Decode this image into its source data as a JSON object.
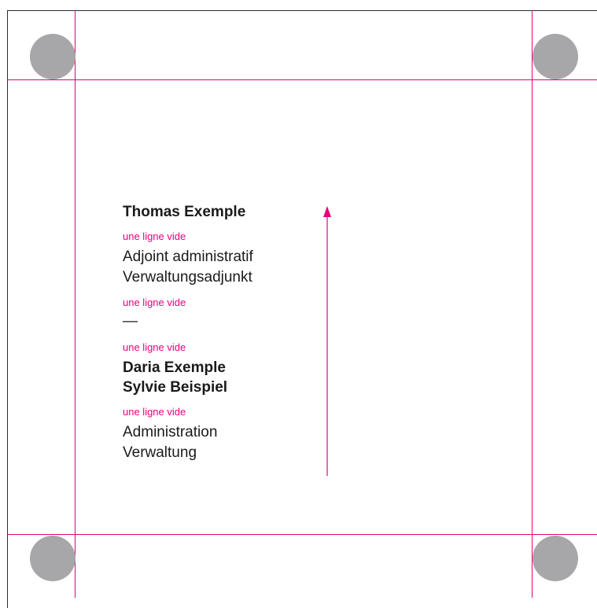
{
  "colors": {
    "guide": "#e6007e",
    "hole": "#a7a7aa",
    "text": "#1a1a1a"
  },
  "card": {
    "name1": "Thomas Exemple",
    "note1": "une ligne vide",
    "title_fr": "Adjoint administratif",
    "title_de": "Verwaltungsadjunkt",
    "note2": "une ligne vide",
    "dash": "—",
    "note3": "une ligne vide",
    "name2": "Daria Exemple",
    "name3": "Sylvie Beispiel",
    "note4": "une ligne vide",
    "dept_fr": "Administration",
    "dept_de": "Verwaltung"
  },
  "icons": {
    "arrow": "arrow-up-icon",
    "hole": "punch-hole-icon"
  }
}
